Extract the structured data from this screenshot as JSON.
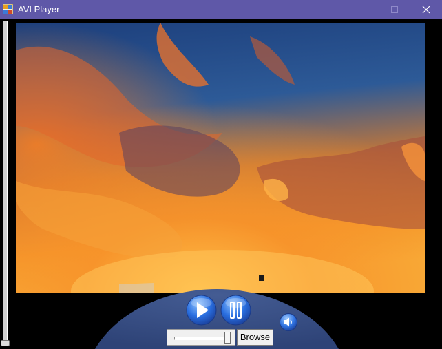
{
  "window": {
    "title": "AVI Player",
    "titlebar_color": "#5f58a8",
    "app_icon": "avi-player-icon"
  },
  "window_controls": {
    "minimize_icon": "minimize-icon",
    "maximize_icon": "maximize-icon",
    "close_icon": "close-icon"
  },
  "video": {
    "content": "sunset sky with orange clouds"
  },
  "controls": {
    "play_icon": "play-icon",
    "pause_icon": "pause-icon",
    "volume_icon": "speaker-icon",
    "browse_label": "Browse",
    "accent": "#2a6fe0",
    "panel_color": "#3a4f86",
    "trackbar_position": 0.95,
    "left_slider_position": 1.0
  }
}
